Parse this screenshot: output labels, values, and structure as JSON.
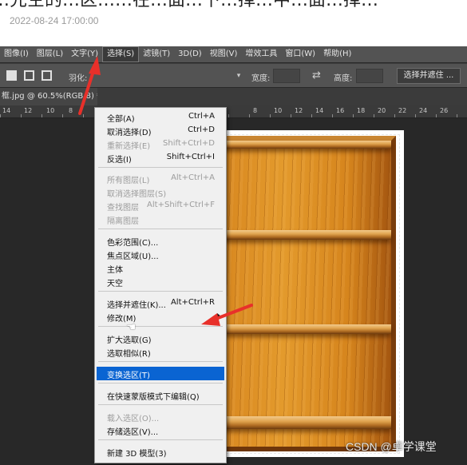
{
  "article": {
    "date": "2022-08-24 17:00:00",
    "header_cut": "…先空的…区……在…面…下…择…中…面…择…"
  },
  "menubar": [
    "图像(I)",
    "图层(L)",
    "文字(Y)",
    "选择(S)",
    "滤镜(T)",
    "3D(D)",
    "视图(V)",
    "增效工具",
    "窗口(W)",
    "帮助(H)"
  ],
  "options": {
    "feather_label": "羽化:",
    "width_label": "宽度:",
    "height_label": "高度:",
    "select_mask_button": "选择并遮住 ..."
  },
  "doc_tab": "框.jpg @ 60.5%(RGB/8) *",
  "ruler_left": [
    "14",
    "12",
    "10",
    "8"
  ],
  "ruler_right": [
    "8",
    "10",
    "12",
    "14",
    "16",
    "18",
    "20",
    "22",
    "24",
    "26"
  ],
  "select_menu": [
    {
      "label": "全部(A)",
      "shortcut": "Ctrl+A"
    },
    {
      "label": "取消选择(D)",
      "shortcut": "Ctrl+D"
    },
    {
      "label": "重新选择(E)",
      "shortcut": "Shift+Ctrl+D"
    },
    {
      "label": "反选(I)",
      "shortcut": "Shift+Ctrl+I"
    },
    {
      "label": "所有图层(L)",
      "shortcut": "Alt+Ctrl+A"
    },
    {
      "label": "取消选择图层(S)",
      "shortcut": ""
    },
    {
      "label": "查找图层",
      "shortcut": "Alt+Shift+Ctrl+F"
    },
    {
      "label": "隔离图层",
      "shortcut": ""
    },
    {
      "label": "色彩范围(C)...",
      "shortcut": ""
    },
    {
      "label": "焦点区域(U)...",
      "shortcut": ""
    },
    {
      "label": "主体",
      "shortcut": ""
    },
    {
      "label": "天空",
      "shortcut": ""
    },
    {
      "label": "选择并遮住(K)...",
      "shortcut": "Alt+Ctrl+R"
    },
    {
      "label": "修改(M)",
      "shortcut": ""
    },
    {
      "label": "扩大选取(G)",
      "shortcut": ""
    },
    {
      "label": "选取相似(R)",
      "shortcut": ""
    },
    {
      "label": "变换选区(T)",
      "shortcut": ""
    },
    {
      "label": "在快速蒙版模式下编辑(Q)",
      "shortcut": ""
    },
    {
      "label": "载入选区(O)...",
      "shortcut": ""
    },
    {
      "label": "存储选区(V)...",
      "shortcut": ""
    },
    {
      "label": "新建 3D 模型(3)",
      "shortcut": ""
    }
  ],
  "watermark": "CSDN @卓学课堂",
  "colors": {
    "menu_highlight": "#0a64d2",
    "arrow": "#e8302a",
    "ps_bg": "#282828",
    "menubar": "#535353"
  }
}
